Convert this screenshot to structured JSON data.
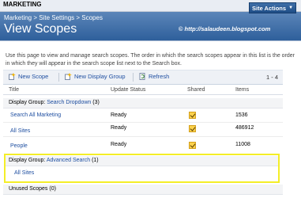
{
  "site": {
    "title": "MARKETING",
    "actions_label": "Site Actions"
  },
  "header": {
    "breadcrumb": "Marketing > Site Settings > Scopes",
    "title": "View Scopes",
    "watermark": "http://salaudeen.blogspot.com"
  },
  "description": "Use this page to view and manage search scopes. The order in which the search scopes appear in this list is the order in which they will appear in the search scope list next to the Search box.",
  "toolbar": {
    "new_scope": "New Scope",
    "new_display_group": "New Display Group",
    "refresh": "Refresh",
    "paging": "1 - 4"
  },
  "columns": {
    "title": "Title",
    "status": "Update Status",
    "shared": "Shared",
    "items": "Items"
  },
  "groups": {
    "search_dropdown": {
      "label": "Display Group:",
      "name": "Search Dropdown",
      "count": "(3)"
    },
    "advanced_search": {
      "label": "Display Group:",
      "name": "Advanced Search",
      "count": "(1)"
    },
    "unused": {
      "label": "Unused Scopes (0)"
    }
  },
  "rows": [
    {
      "title": "Search All Marketing",
      "status": "Ready",
      "shared": true,
      "items": "1536"
    },
    {
      "title": "All Sites",
      "status": "Ready",
      "shared": true,
      "items": "486912"
    },
    {
      "title": "People",
      "status": "Ready",
      "shared": true,
      "items": "11008"
    }
  ],
  "advanced_row": {
    "title": "All Sites"
  },
  "colors": {
    "header_blue": "#2e5f9b",
    "link": "#1f4fa1",
    "highlight": "#f4ee28",
    "checkbox": "#fbd14b"
  }
}
